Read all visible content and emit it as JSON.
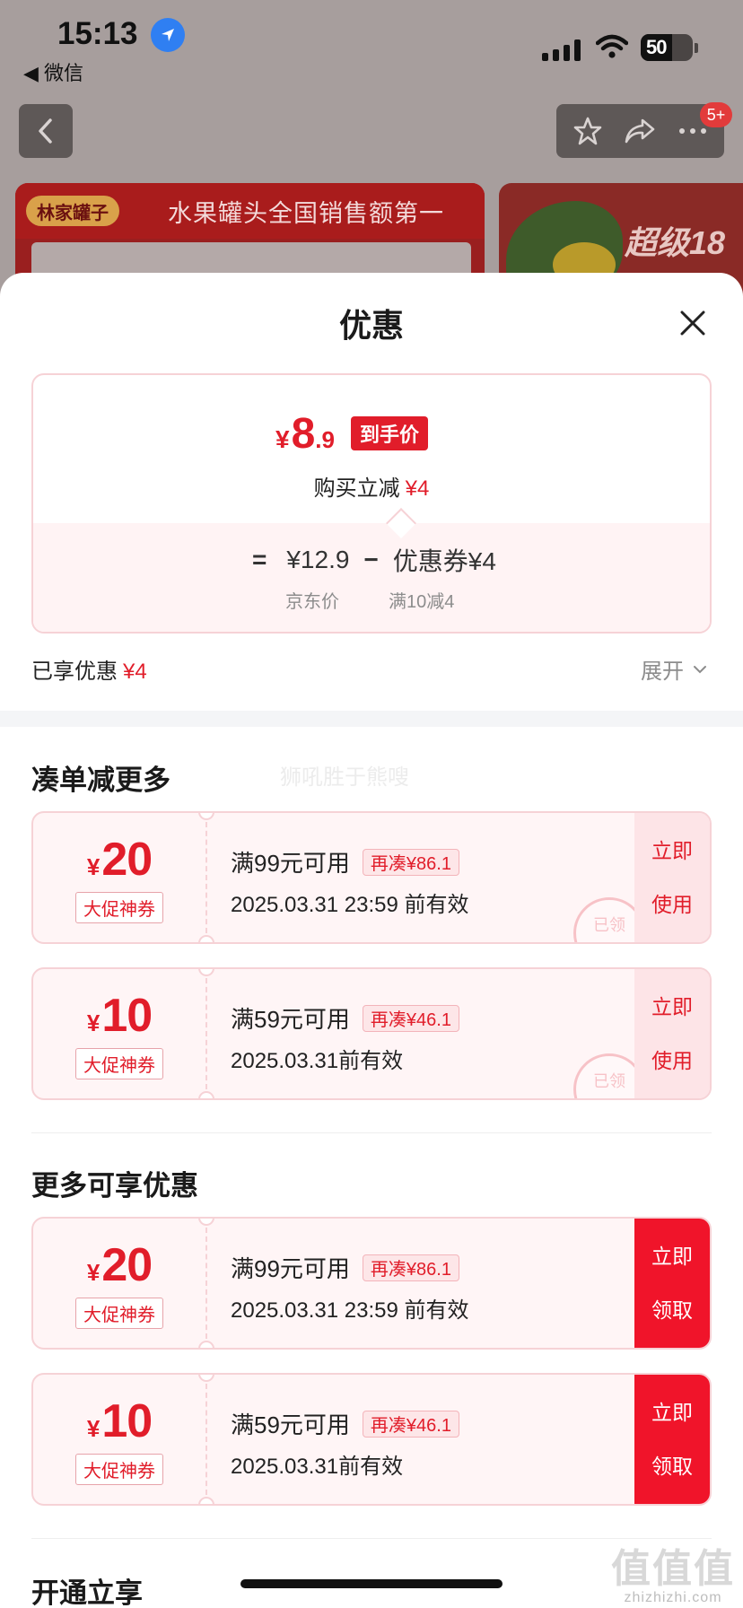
{
  "status_bar": {
    "time": "15:13",
    "back_app": "◀ 微信",
    "battery": "50"
  },
  "nav": {
    "badge": "5+"
  },
  "banner": {
    "brand": "林家罐子",
    "title": "水果罐头全国销售额第一",
    "right_tag": "超级18"
  },
  "sheet": {
    "title": "优惠",
    "price_card": {
      "yen": "¥",
      "price_int": "8",
      "price_dec": ".9",
      "hand_tag": "到手价",
      "instant_label": "购买立减",
      "instant_amount": "¥4",
      "formula_eq": "=",
      "jd_price": "¥12.9",
      "minus": "−",
      "coupon_part": "优惠券¥4",
      "jd_price_label": "京东价",
      "coupon_rule": "满10减4"
    },
    "enjoyed_label": "已享优惠",
    "enjoyed_amount": "¥4",
    "expand_label": "展开",
    "watermark": "狮吼胜于熊嗖",
    "section1_title": "凑单减更多",
    "section2_title": "更多可享优惠",
    "section3_title": "开通立享",
    "coupons_more": [
      {
        "yen": "¥",
        "amount": "20",
        "label": "大促神券",
        "condition": "满99元可用",
        "need": "再凑¥86.1",
        "expiry": "2025.03.31 23:59 前有效",
        "action1": "立即",
        "action2": "使用",
        "stamp": "已领"
      },
      {
        "yen": "¥",
        "amount": "10",
        "label": "大促神券",
        "condition": "满59元可用",
        "need": "再凑¥46.1",
        "expiry": "2025.03.31前有效",
        "action1": "立即",
        "action2": "使用",
        "stamp": "已领"
      }
    ],
    "coupons_available": [
      {
        "yen": "¥",
        "amount": "20",
        "label": "大促神券",
        "condition": "满99元可用",
        "need": "再凑¥86.1",
        "expiry": "2025.03.31 23:59 前有效",
        "action1": "立即",
        "action2": "领取"
      },
      {
        "yen": "¥",
        "amount": "10",
        "label": "大促神券",
        "condition": "满59元可用",
        "need": "再凑¥46.1",
        "expiry": "2025.03.31前有效",
        "action1": "立即",
        "action2": "领取"
      }
    ]
  },
  "site_mark": {
    "big": "值值值",
    "small": "zhizhizhi.com"
  },
  "colors": {
    "accent": "#e11d2a",
    "action_red": "#f0142a",
    "card_border": "#f6d2d6"
  },
  "icons": [
    "location-arrow-icon",
    "signal-icon",
    "wifi-icon",
    "back-arrow-icon",
    "star-icon",
    "share-icon",
    "more-icon",
    "close-icon",
    "chevron-down-icon"
  ]
}
